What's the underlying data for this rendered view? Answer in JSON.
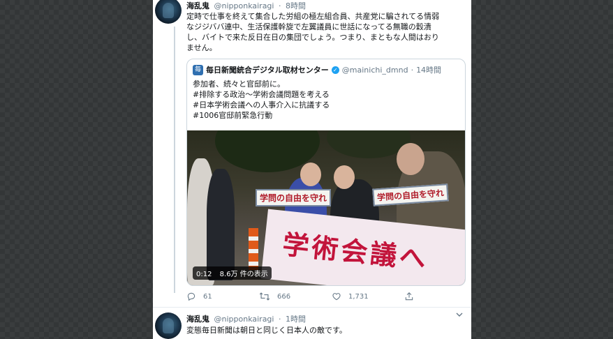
{
  "tweet1": {
    "name": "海乱鬼",
    "handle": "@nipponkairagi",
    "dot": "·",
    "time": "8時間",
    "text": "定時で仕事を終えて集合した労組の極左組合員、共産党に騙されてる情弱\nなジジババ連中、生活保護幹旋で左翼議員に世話になってる無職の穀潰\nし、バイトで来た反日在日の集団でしょう。つまり、まともな人間はおり\nません。",
    "quote": {
      "avatar_glyph": "毎",
      "name": "毎日新聞統合デジタル取材センター",
      "verified_glyph": "✓",
      "handle": "@mainichi_dmnd",
      "dot": "·",
      "time": "14時間",
      "text": "参加者、続々と官邸前に。\n#排除する政治〜学術会議問題を考える\n#日本学術会議への人事介入に抗議する\n#1006官邸前緊急行動",
      "video": {
        "duration": "0:12",
        "views": "8.6万 件の表示",
        "sign_left": "学問の自由を守れ",
        "sign_right": "学問の自由を守れ",
        "banner": "学術会議へ"
      }
    },
    "actions": {
      "reply_count": "61",
      "retweet_count": "666",
      "like_count": "1,731"
    }
  },
  "tweet2": {
    "name": "海乱鬼",
    "handle": "@nipponkairagi",
    "dot": "·",
    "time": "1時間",
    "text": "変態毎日新聞は朝日と同じく日本人の敵です。"
  },
  "colors": {
    "accent": "#1da1f2",
    "muted": "#657786",
    "background_pattern": "#3a3d3e"
  },
  "icons": [
    "reply-icon",
    "retweet-icon",
    "like-icon",
    "share-icon",
    "chevron-down-icon",
    "verified-icon"
  ]
}
